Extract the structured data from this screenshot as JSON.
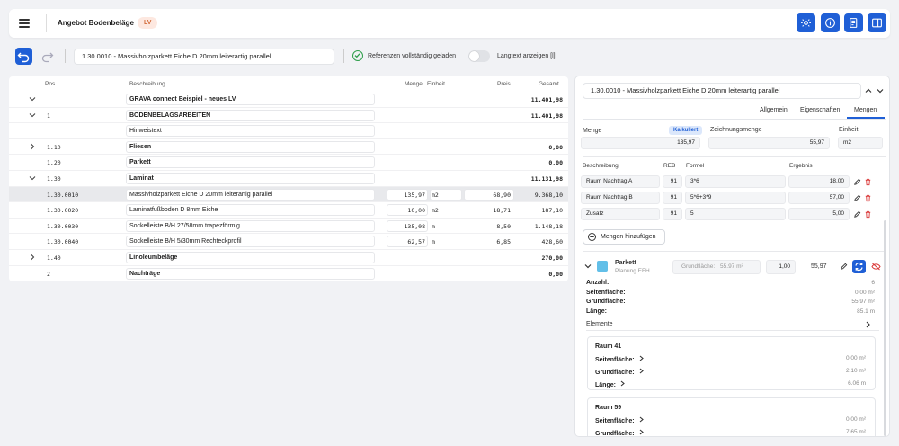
{
  "header": {
    "title": "Angebot Bodenbeläge",
    "badge": "LV",
    "icons": [
      "gear-icon",
      "info-icon",
      "document-edit-icon",
      "sidebar-toggle-icon"
    ]
  },
  "toolbar": {
    "search_value": "1.30.0010 - Massivholzparkett Eiche D 20mm leiterartig parallel",
    "references_status": "Referenzen vollständig geladen",
    "longtext_label": "Langtext anzeigen [l]",
    "longtext_enabled": false
  },
  "table": {
    "columns": {
      "pos": "Pos",
      "desc": "Beschreibung",
      "qty": "Menge",
      "unit": "Einheit",
      "price": "Preis",
      "total": "Gesamt"
    },
    "rows": [
      {
        "pos": "",
        "desc": "GRAVA connect Beispiel - neues LV",
        "qty": "",
        "unit": "",
        "price": "",
        "total": "11.401,98",
        "bold": true,
        "chev": "down"
      },
      {
        "pos": "1",
        "desc": "BODENBELAGSARBEITEN",
        "qty": "",
        "unit": "",
        "price": "",
        "total": "11.401,98",
        "bold": true,
        "chev": "down"
      },
      {
        "pos": "",
        "desc": "Hinweistext",
        "qty": "",
        "unit": "",
        "price": "",
        "total": "",
        "bold": false,
        "chev": ""
      },
      {
        "pos": "1.10",
        "desc": "Fliesen",
        "qty": "",
        "unit": "",
        "price": "",
        "total": "0,00",
        "bold": true,
        "chev": "right"
      },
      {
        "pos": "1.20",
        "desc": "Parkett",
        "qty": "",
        "unit": "",
        "price": "",
        "total": "0,00",
        "bold": true,
        "chev": ""
      },
      {
        "pos": "1.30",
        "desc": "Laminat",
        "qty": "",
        "unit": "",
        "price": "",
        "total": "11.131,98",
        "bold": true,
        "chev": "down"
      },
      {
        "pos": "1.30.0010",
        "desc": "Massivholzparkett Eiche D 20mm leiterartig parallel",
        "qty": "135,97",
        "unit": "m2",
        "price": "68,90",
        "total": "9.368,10",
        "bold": false,
        "chev": "",
        "selected": true
      },
      {
        "pos": "1.30.0020",
        "desc": "Laminatfußboden D 8mm Eiche",
        "qty": "10,00",
        "unit": "m2",
        "price": "18,71",
        "total": "187,10",
        "bold": false,
        "chev": ""
      },
      {
        "pos": "1.30.0030",
        "desc": "Sockelleiste B/H 27/58mm trapezförmig",
        "qty": "135,08",
        "unit": "m",
        "price": "8,50",
        "total": "1.148,18",
        "bold": false,
        "chev": ""
      },
      {
        "pos": "1.30.0040",
        "desc": "Sockelleiste B/H 5/30mm Rechteckprofil",
        "qty": "62,57",
        "unit": "m",
        "price": "6,85",
        "total": "428,60",
        "bold": false,
        "chev": ""
      },
      {
        "pos": "1.40",
        "desc": "Linoleumbeläge",
        "qty": "",
        "unit": "",
        "price": "",
        "total": "270,00",
        "bold": true,
        "chev": "right"
      },
      {
        "pos": "2",
        "desc": "Nachträge",
        "qty": "",
        "unit": "",
        "price": "",
        "total": "0,00",
        "bold": true,
        "chev": ""
      }
    ]
  },
  "panel": {
    "title": "1.30.0010 - Massivholzparkett Eiche D 20mm leiterartig parallel",
    "tabs": [
      "Allgemein",
      "Eigenschaften",
      "Mengen"
    ],
    "active_tab": "Mengen",
    "menge_label": "Menge",
    "kalkuliert": "Kalkuliert",
    "menge_value": "135,97",
    "zeichnungsmenge_label": "Zeichnungsmenge",
    "zeichnungsmenge_value": "55,97",
    "einheit_label": "Einheit",
    "einheit_value": "m2",
    "calc_columns": {
      "desc": "Beschreibung",
      "reb": "REB",
      "formel": "Formel",
      "ergebnis": "Ergebnis"
    },
    "calc_rows": [
      {
        "desc": "Raum Nachtrag A",
        "reb": "91",
        "formel": "3*6",
        "ergebnis": "18,00"
      },
      {
        "desc": "Raum Nachtrag B",
        "reb": "91",
        "formel": "5*6+3*9",
        "ergebnis": "57,00"
      },
      {
        "desc": "Zusatz",
        "reb": "91",
        "formel": "5",
        "ergebnis": "5,00"
      }
    ],
    "add_button": "Mengen hinzufügen",
    "drawing": {
      "name": "Parkett",
      "sub": "Planung EFH",
      "grundflaeche_label": "Grundfläche:",
      "grundflaeche_value": "55.97 m²",
      "factor": "1,00",
      "result": "55,97",
      "color": "#62bfe8"
    },
    "stats": [
      {
        "label": "Anzahl:",
        "value": "6"
      },
      {
        "label": "Seitenfläche:",
        "value": "0.00 m²"
      },
      {
        "label": "Grundfläche:",
        "value": "55.97 m²"
      },
      {
        "label": "Länge:",
        "value": "85.1 m"
      }
    ],
    "elemente_label": "Elemente",
    "rooms": [
      {
        "name": "Raum 41",
        "items": [
          {
            "label": "Seitenfläche:",
            "value": "0.00 m²"
          },
          {
            "label": "Grundfläche:",
            "value": "2.10 m²"
          },
          {
            "label": "Länge:",
            "value": "6.06 m"
          }
        ]
      },
      {
        "name": "Raum 59",
        "items": [
          {
            "label": "Seitenfläche:",
            "value": "0.00 m²"
          },
          {
            "label": "Grundfläche:",
            "value": "7.65 m²"
          }
        ]
      }
    ]
  }
}
